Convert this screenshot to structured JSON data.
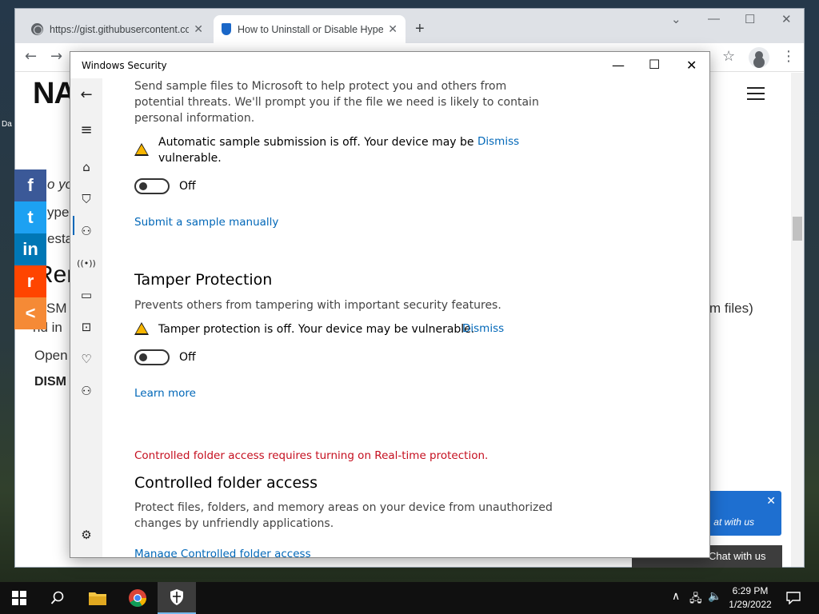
{
  "desktop": {
    "label": "Da"
  },
  "browser": {
    "tabs": [
      {
        "title": "https://gist.githubusercontent.com",
        "close": "✕"
      },
      {
        "title": "How to Uninstall or Disable Hype",
        "close": "✕"
      }
    ],
    "new_tab": "+",
    "window_controls": {
      "dropdown": "⌄",
      "minimize": "—",
      "maximize": "☐",
      "close": "✕"
    },
    "nav": {
      "back": "←",
      "forward": "→",
      "star": "☆",
      "menu": "⋮"
    },
    "page": {
      "logo": "NA",
      "fragments": [
        "o yo",
        "ype",
        "esta",
        "Ren",
        "DISM",
        "nd in",
        "Open",
        "DISM",
        "m files)"
      ],
      "share": [
        {
          "icon": "facebook-icon",
          "glyph": "f",
          "color": "#3b5998"
        },
        {
          "icon": "twitter-icon",
          "glyph": "t",
          "color": "#1da1f2"
        },
        {
          "icon": "linkedin-icon",
          "glyph": "in",
          "color": "#0077b5"
        },
        {
          "icon": "reddit-icon",
          "glyph": "r",
          "color": "#ff4500"
        },
        {
          "icon": "share-icon",
          "glyph": "<",
          "color": "#f58a36"
        }
      ],
      "chat_popup": {
        "close": "✕",
        "text": "at with us"
      },
      "chat_bar": {
        "text": "Chat with us"
      }
    }
  },
  "security": {
    "title": "Windows Security",
    "controls": {
      "minimize": "—",
      "maximize": "☐",
      "close": "✕"
    },
    "nav": {
      "back": "←",
      "menu": "≡",
      "home": "⌂",
      "shield": "⛉",
      "account": "⚇",
      "network": "((•))",
      "app": "▭",
      "device": "⊡",
      "health": "♡",
      "family": "⚇",
      "settings": "⚙"
    },
    "sample": {
      "description_line1": "Send sample files to Microsoft to help protect you and others from",
      "description_line2": "potential threats. We'll prompt you if the file we need is likely to contain",
      "description_line3": "personal information.",
      "warning_line1": "Automatic sample submission is off. Your device may be",
      "warning_line2": "vulnerable.",
      "dismiss": "Dismiss",
      "toggle_label": "Off",
      "submit_link": "Submit a sample manually"
    },
    "tamper": {
      "heading": "Tamper Protection",
      "description": "Prevents others from tampering with important security features.",
      "warning": "Tamper protection is off. Your device may be vulnerable.",
      "dismiss": "Dismiss",
      "toggle_label": "Off",
      "learn_more": "Learn more"
    },
    "cfa": {
      "error": "Controlled folder access requires turning on Real-time protection.",
      "heading": "Controlled folder access",
      "description_line1": "Protect files, folders, and memory areas on your device from unauthorized",
      "description_line2": "changes by unfriendly applications.",
      "manage_link": "Manage Controlled folder access"
    }
  },
  "taskbar": {
    "time": "6:29 PM",
    "date": "1/29/2022",
    "tray": {
      "chevron": "∧",
      "network": "🖧",
      "volume": "🔈"
    }
  }
}
